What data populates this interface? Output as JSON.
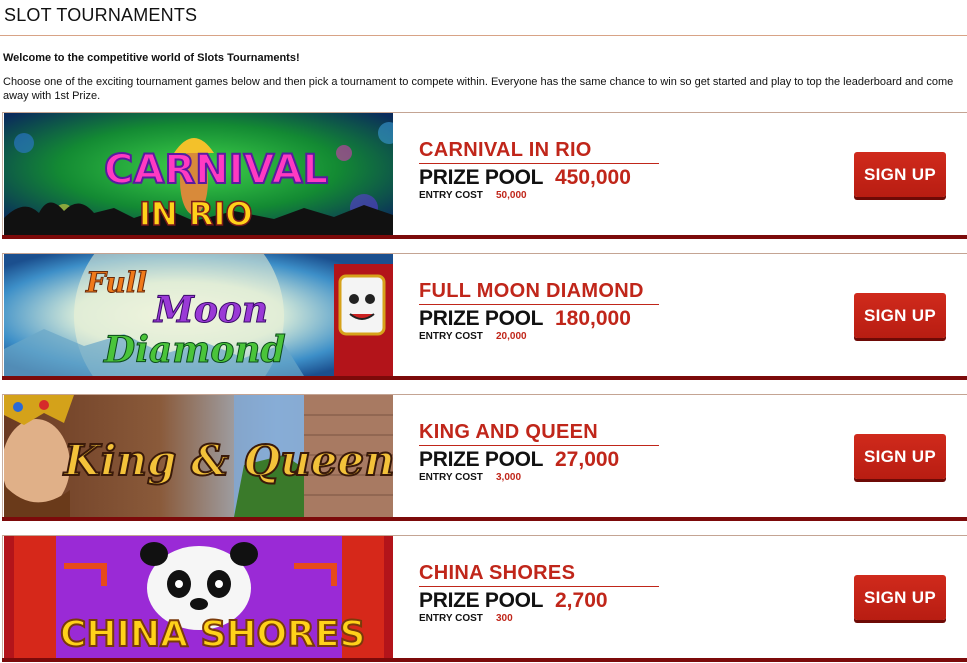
{
  "header": {
    "title": "SLOT TOURNAMENTS",
    "welcome": "Welcome to the competitive world of Slots Tournaments!",
    "intro": "Choose one of the exciting tournament games below and then pick a tournament to compete within. Everyone has the same chance to win so get started and play to top the leaderboard and come away with 1st Prize."
  },
  "labels": {
    "prize_pool": "PRIZE POOL",
    "entry_cost": "ENTRY COST",
    "sign_up": "SIGN UP"
  },
  "tournaments": [
    {
      "name": "CARNIVAL IN RIO",
      "prize_pool": "450,000",
      "entry_cost": "50,000",
      "banner": {
        "top_text": "CARNIVAL",
        "bottom_text": "IN RIO"
      }
    },
    {
      "name": "FULL MOON DIAMOND",
      "prize_pool": "180,000",
      "entry_cost": "20,000",
      "banner": {
        "top_text": "Full",
        "mid_text": "Moon",
        "bottom_text": "Diamond"
      }
    },
    {
      "name": "KING AND QUEEN",
      "prize_pool": "27,000",
      "entry_cost": "3,000",
      "banner": {
        "top_text": "King & Queen"
      }
    },
    {
      "name": "CHINA SHORES",
      "prize_pool": "2,700",
      "entry_cost": "300",
      "banner": {
        "top_text": "CHINA SHORES"
      }
    }
  ],
  "colors": {
    "accent_red": "#c0261a",
    "dark_red_bar": "#7c0a0a",
    "rule": "#d8a386"
  }
}
